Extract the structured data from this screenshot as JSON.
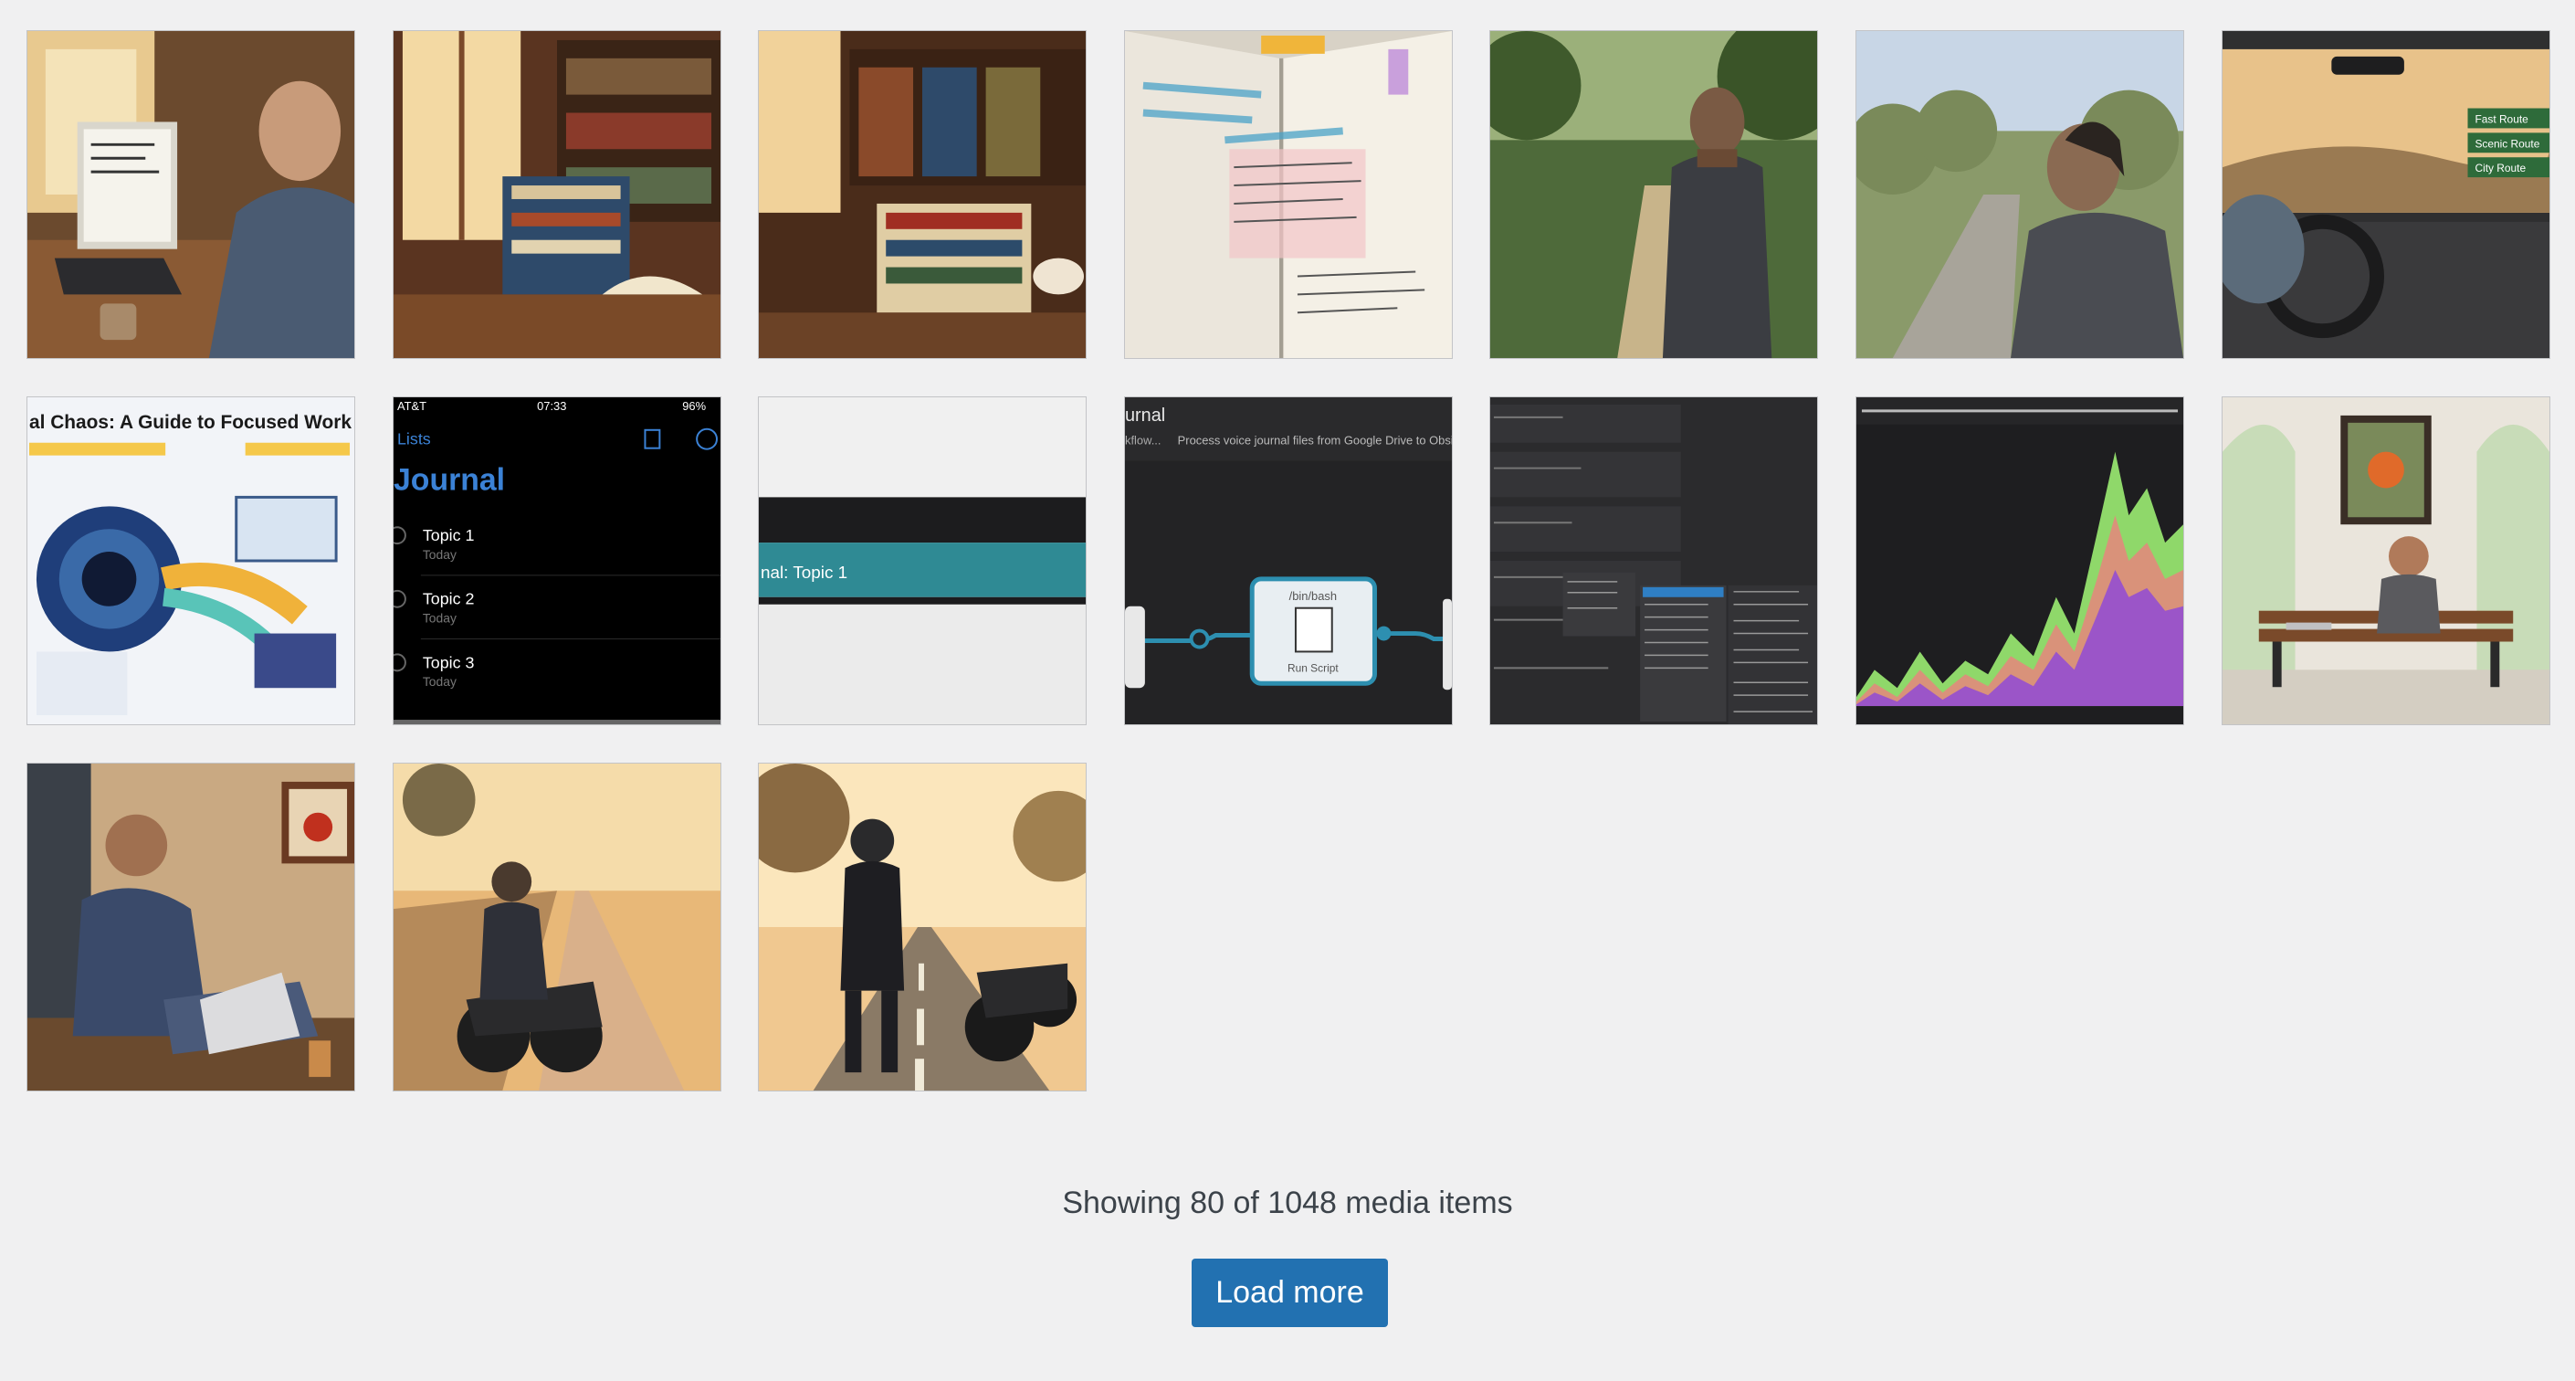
{
  "library": {
    "status_text": "Showing 80 of 1048 media items",
    "load_more_label": "Load more"
  },
  "tiles": {
    "infographic": {
      "title": "al Chaos: A Guide to Focused Work & Inter"
    },
    "notes": {
      "carrier": "AT&T",
      "time": "07:33",
      "battery": "96%",
      "back_label": "Lists",
      "heading": "Journal",
      "items": [
        {
          "title": "Topic 1",
          "date": "Today"
        },
        {
          "title": "Topic 2",
          "date": "Today"
        },
        {
          "title": "Topic 3",
          "date": "Today"
        }
      ]
    },
    "crop": {
      "label": "nal: Topic 1"
    },
    "workflow": {
      "title": "urnal",
      "subtitle": "kflow...",
      "description": "Process voice journal files from Google Drive to Obsid",
      "node_title": "/bin/bash",
      "node_label": "Run Script"
    },
    "route_signs": [
      "Fast Route",
      "Scenic Route",
      "City Route"
    ]
  },
  "colors": {
    "accent": "#2271b1",
    "page_bg": "#f0f0f1",
    "status_text": "#3c434a",
    "tile_border": "#c3c4c7"
  }
}
